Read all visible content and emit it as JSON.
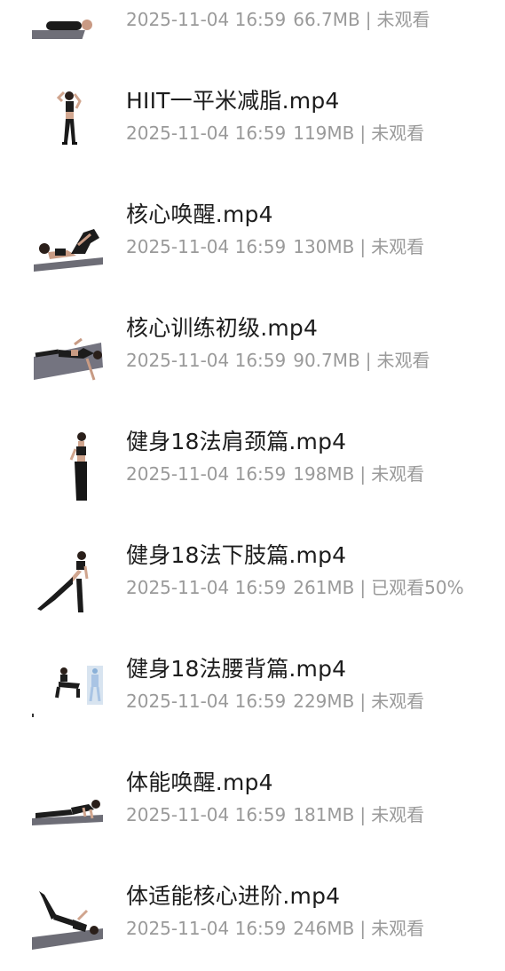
{
  "videos": [
    {
      "title": "",
      "date": "2025-11-04 16:59",
      "size": "66.7MB",
      "status": "未观看",
      "pose": "floor-plank"
    },
    {
      "title": "HIIT一平米减脂.mp4",
      "date": "2025-11-04 16:59",
      "size": "119MB",
      "status": "未观看",
      "pose": "standing-stretch"
    },
    {
      "title": "核心唤醒.mp4",
      "date": "2025-11-04 16:59",
      "size": "130MB",
      "status": "未观看",
      "pose": "lying-knee"
    },
    {
      "title": "核心训练初级.mp4",
      "date": "2025-11-04 16:59",
      "size": "90.7MB",
      "status": "未观看",
      "pose": "lying-flat"
    },
    {
      "title": "健身18法肩颈篇.mp4",
      "date": "2025-11-04 16:59",
      "size": "198MB",
      "status": "未观看",
      "pose": "standing-side"
    },
    {
      "title": "健身18法下肢篇.mp4",
      "date": "2025-11-04 16:59",
      "size": "261MB",
      "status": "已观看50%",
      "pose": "lunge"
    },
    {
      "title": "健身18法腰背篇.mp4",
      "date": "2025-11-04 16:59",
      "size": "229MB",
      "status": "未观看",
      "pose": "seated-anatomy"
    },
    {
      "title": "体能唤醒.mp4",
      "date": "2025-11-04 16:59",
      "size": "181MB",
      "status": "未观看",
      "pose": "pushup"
    },
    {
      "title": "体适能核心进阶.mp4",
      "date": "2025-11-04 16:59",
      "size": "246MB",
      "status": "未观看",
      "pose": "leg-raise"
    }
  ],
  "separator": "|"
}
